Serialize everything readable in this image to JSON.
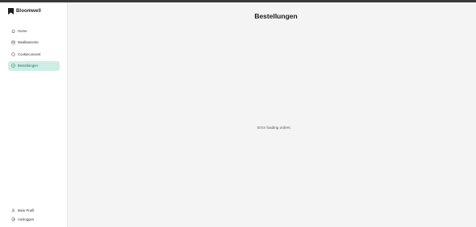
{
  "brand": {
    "name": "Bloomwell",
    "logo_icon": "bookmark-logo-icon"
  },
  "nav": {
    "items": [
      {
        "label": "Home",
        "icon": "home-icon",
        "active": false
      },
      {
        "label": "Medikamente",
        "icon": "pill-icon",
        "active": false
      },
      {
        "label": "Cookieconsent",
        "icon": "cookie-icon",
        "active": false
      },
      {
        "label": "Bestellungen",
        "icon": "orders-icon",
        "active": true
      }
    ]
  },
  "bottom_nav": {
    "items": [
      {
        "label": "Mein Profil",
        "icon": "user-icon"
      },
      {
        "label": "Ausloggen",
        "icon": "logout-icon"
      }
    ]
  },
  "main": {
    "title": "Bestellungen",
    "error": "Error loading orders."
  },
  "colors": {
    "active_bg": "#cdeee4",
    "active_text": "#1f6f5a",
    "topbar": "#3a3a3a"
  }
}
